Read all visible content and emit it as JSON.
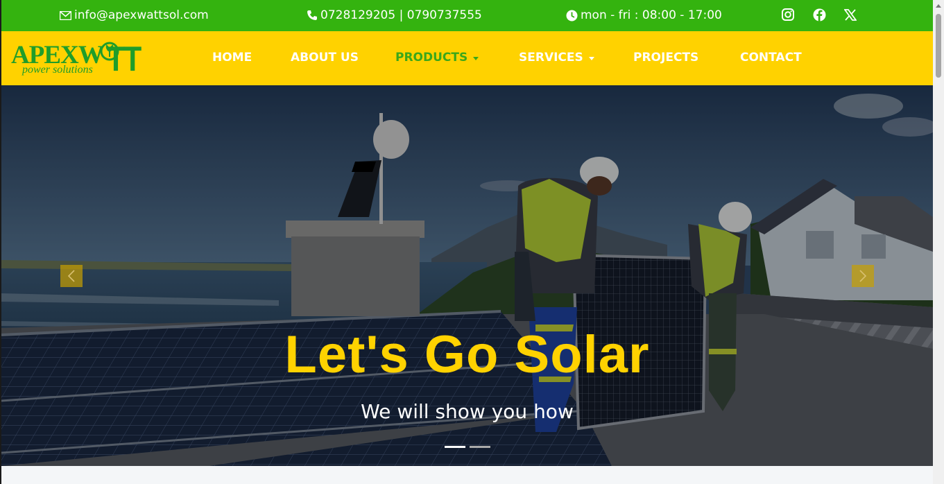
{
  "topbar": {
    "email": "info@apexwattsol.com",
    "phone": "0728129205 | 0790737555",
    "hours": "mon - fri : 08:00 - 17:00",
    "socials": [
      "instagram-icon",
      "facebook-icon",
      "x-icon"
    ]
  },
  "logo": {
    "main": "APEXW",
    "end": "TT",
    "tagline": "power solutions"
  },
  "nav": {
    "items": [
      {
        "label": "HOME"
      },
      {
        "label": "ABOUT US"
      },
      {
        "label": "PRODUCTS"
      },
      {
        "label": "SERVICES"
      },
      {
        "label": "PROJECTS"
      },
      {
        "label": "CONTACT"
      }
    ]
  },
  "hero": {
    "title": "Let's Go Solar",
    "subtitle": "We will show you how",
    "active_slide": 1,
    "slide_count": 2
  },
  "colors": {
    "topbar": "#34b30f",
    "nav": "#ffd200",
    "accent_green": "#1f9d2a",
    "headline": "#ffd200"
  }
}
